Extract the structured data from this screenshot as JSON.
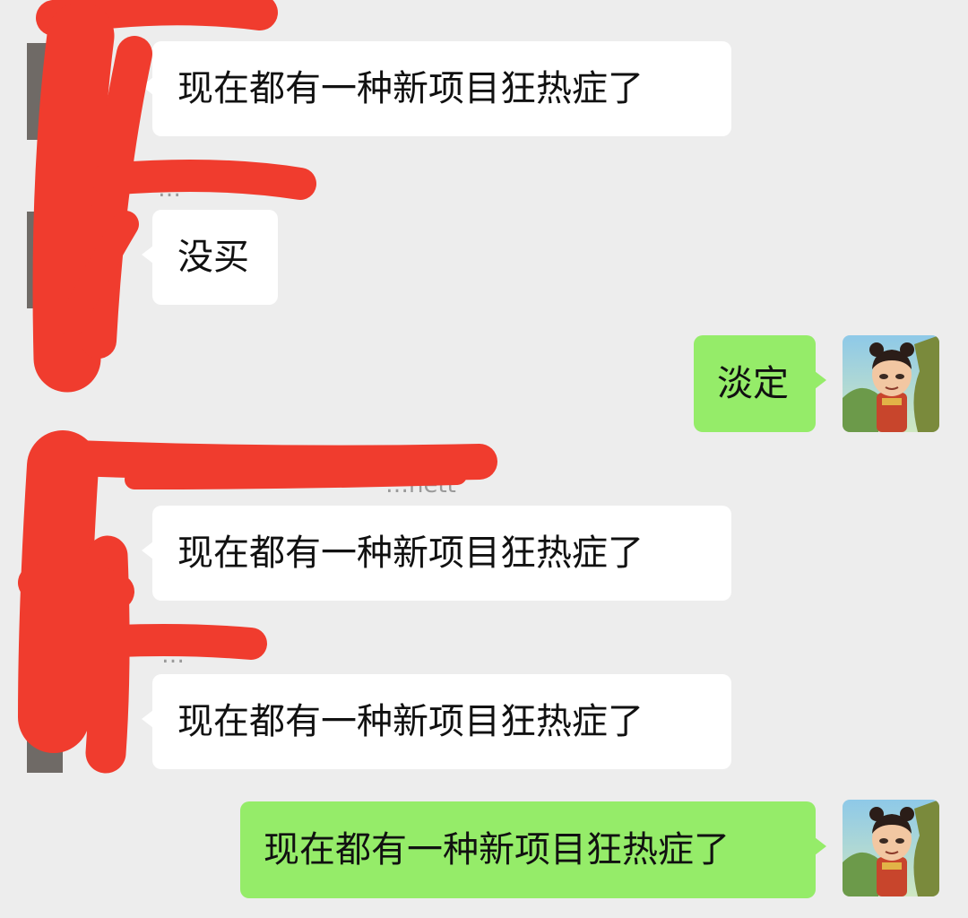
{
  "messages": [
    {
      "side": "left",
      "text": "现在都有一种新项目狂热症了"
    },
    {
      "side": "left",
      "sender": "…",
      "text": "没买"
    },
    {
      "side": "right",
      "text": "淡定",
      "avatar": "cartoon-character-avatar"
    },
    {
      "side": "left",
      "sender": "…nett",
      "text": "现在都有一种新项目狂热症了"
    },
    {
      "side": "left",
      "sender": "…",
      "text": "现在都有一种新项目狂热症了"
    },
    {
      "side": "right",
      "text": "现在都有一种新项目狂热症了",
      "avatar": "cartoon-character-avatar"
    }
  ],
  "colors": {
    "background": "#ededed",
    "incoming_bubble": "#ffffff",
    "outgoing_bubble": "#95ec69",
    "redaction": "#f03c2e"
  }
}
